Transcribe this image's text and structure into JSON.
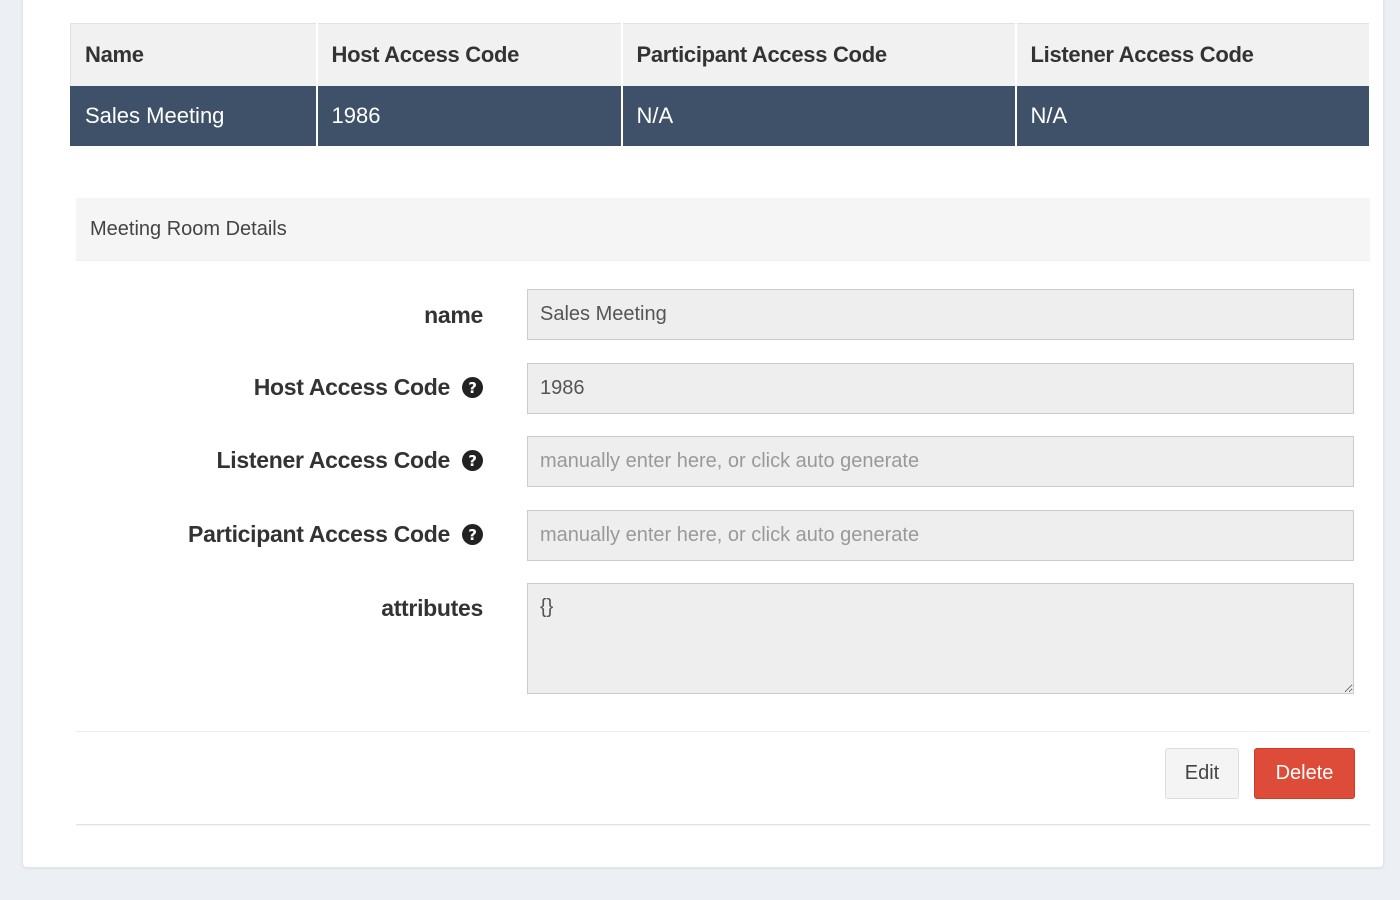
{
  "table": {
    "columns": [
      "Name",
      "Host Access Code",
      "Participant Access Code",
      "Listener Access Code"
    ],
    "rows": [
      {
        "name": "Sales Meeting",
        "host_code": "1986",
        "participant_code": "N/A",
        "listener_code": "N/A"
      }
    ]
  },
  "panel": {
    "title": "Meeting Room Details",
    "fields": {
      "name": {
        "label": "name",
        "value": "Sales Meeting"
      },
      "host_code": {
        "label": "Host Access Code",
        "value": "1986"
      },
      "listener_code": {
        "label": "Listener Access Code",
        "value": "",
        "placeholder": "manually enter here, or click auto generate"
      },
      "participant_code": {
        "label": "Participant Access Code",
        "value": "",
        "placeholder": "manually enter here, or click auto generate"
      },
      "attributes": {
        "label": "attributes",
        "value": "{}"
      }
    },
    "buttons": {
      "edit": "Edit",
      "delete": "Delete"
    }
  },
  "colors": {
    "selected_row": "#3e5168",
    "delete_button": "#dd4b39",
    "page_background": "#eceff3"
  },
  "icons": {
    "help": "question-circle-icon"
  }
}
